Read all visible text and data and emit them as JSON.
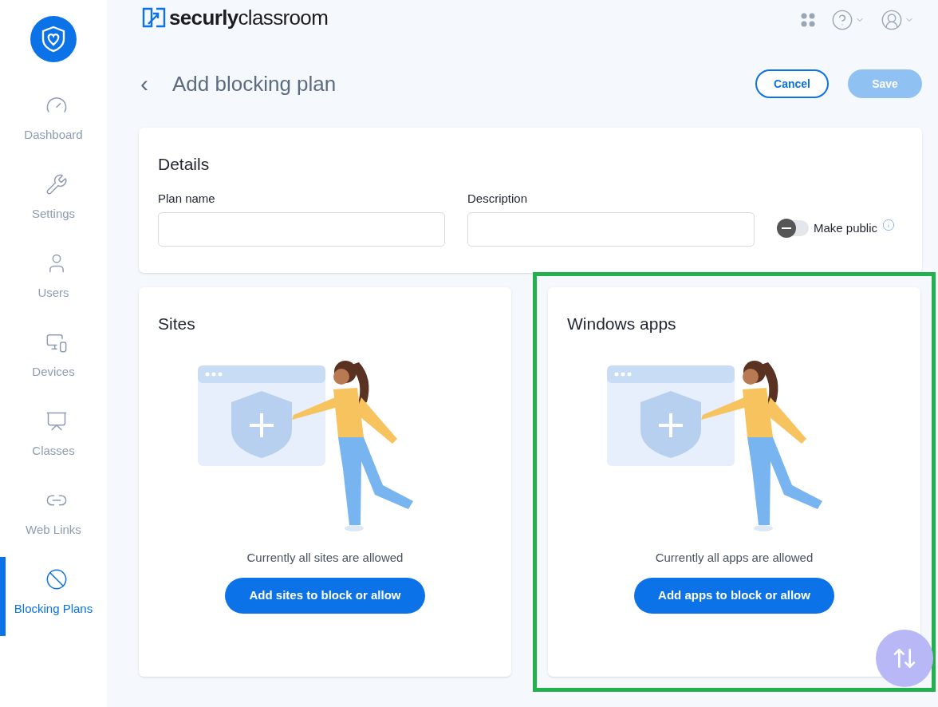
{
  "brand": {
    "bold": "securly",
    "light": "classroom"
  },
  "sidebar": {
    "items": [
      {
        "label": "Dashboard",
        "selected": false
      },
      {
        "label": "Settings",
        "selected": false
      },
      {
        "label": "Users",
        "selected": false
      },
      {
        "label": "Devices",
        "selected": false
      },
      {
        "label": "Classes",
        "selected": false
      },
      {
        "label": "Web Links",
        "selected": false
      },
      {
        "label": "Blocking Plans",
        "selected": true
      }
    ]
  },
  "page": {
    "title": "Add blocking plan",
    "back": "‹",
    "cancel": "Cancel",
    "save": {
      "label": "Save",
      "disabled": true
    }
  },
  "details": {
    "title": "Details",
    "plan_name": {
      "label": "Plan name"
    },
    "description": {
      "label": "Description"
    },
    "make_public": {
      "label": "Make public",
      "on": false
    }
  },
  "cards": [
    {
      "title": "Sites",
      "message": "Currently all sites are allowed",
      "button": "Add sites to block or allow",
      "highlighted": false
    },
    {
      "title": "Windows apps",
      "message": "Currently all apps are allowed",
      "button": "Add apps to block or allow",
      "highlighted": true
    }
  ]
}
